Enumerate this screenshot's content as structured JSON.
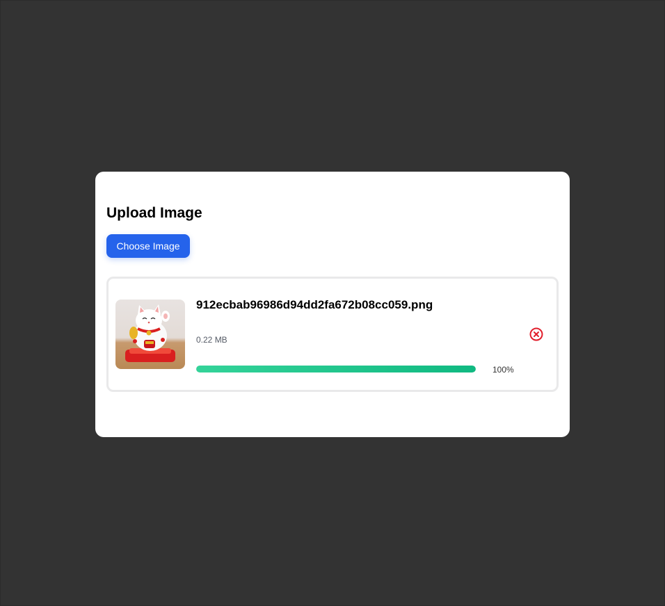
{
  "modal": {
    "title": "Upload Image",
    "choose_button_label": "Choose Image"
  },
  "file": {
    "name": "912ecbab96986d94dd2fa672b08cc059.png",
    "size": "0.22 MB",
    "progress_percent": 100,
    "progress_label": "100%",
    "thumbnail_icon": "maneki-neko-image"
  },
  "colors": {
    "background": "#333333",
    "accent": "#2563eb",
    "progress_start": "#34d399",
    "progress_end": "#10b981",
    "remove": "#e11d2a"
  },
  "icons": {
    "remove": "close-circle-icon"
  }
}
